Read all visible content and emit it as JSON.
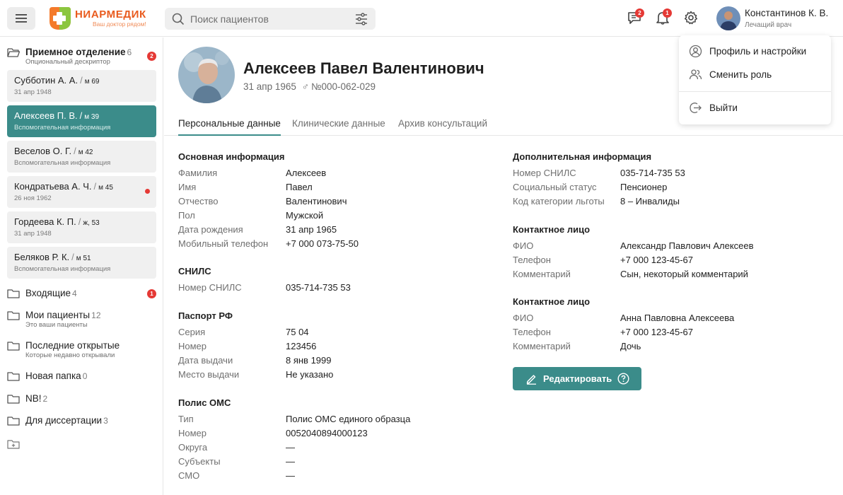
{
  "header": {
    "logo_name": "НИАРМЕДИК",
    "logo_tagline": "Ваш доктор рядом!",
    "search_placeholder": "Поиск пациентов",
    "messages_badge": "2",
    "notifications_badge": "1",
    "user_name": "Константинов К. В.",
    "user_role": "Лечащий врач"
  },
  "dropdown": {
    "profile": "Профиль и настройки",
    "switch_role": "Сменить роль",
    "logout": "Выйти"
  },
  "sidebar": {
    "reception": {
      "name": "Приемное отделение",
      "count": "6",
      "desc": "Опциональный дескриптор",
      "badge": "2"
    },
    "patients": [
      {
        "name": "Субботин А. А.",
        "meta": "м 69",
        "sub": "31 апр 1948"
      },
      {
        "name": "Алексеев П. В.",
        "meta": "м 39",
        "sub": "Вспомогательная информация"
      },
      {
        "name": "Веселов О. Г.",
        "meta": "м 42",
        "sub": "Вспомогательная информация"
      },
      {
        "name": "Кондратьева А. Ч.",
        "meta": "м 45",
        "sub": "26 ноя 1962"
      },
      {
        "name": "Гордеева К. П.",
        "meta": "ж, 53",
        "sub": "31 апр 1948"
      },
      {
        "name": "Беляков Р. К.",
        "meta": "м 51",
        "sub": "Вспомогательная информация"
      }
    ],
    "folders": [
      {
        "name": "Входящие",
        "count": "4",
        "desc": "",
        "badge": "1"
      },
      {
        "name": "Мои пациенты",
        "count": "12",
        "desc": "Это ваши пациенты"
      },
      {
        "name": "Последние открытые",
        "count": "",
        "desc": "Которые недавно открывали"
      },
      {
        "name": "Новая папка",
        "count": "0",
        "desc": ""
      },
      {
        "name": "NB!",
        "count": "2",
        "desc": ""
      },
      {
        "name": "Для диссертации",
        "count": "3",
        "desc": ""
      }
    ]
  },
  "patient": {
    "name": "Алексеев Павел Валентинович",
    "birth": "31 апр 1965",
    "gender_symbol": "♂",
    "card_number": "№000-062-029"
  },
  "tabs": [
    "Персональные данные",
    "Клинические данные",
    "Архив консультаций"
  ],
  "basic": {
    "title": "Основная информация",
    "rows": [
      {
        "label": "Фамилия",
        "value": "Алексеев"
      },
      {
        "label": "Имя",
        "value": "Павел"
      },
      {
        "label": "Отчество",
        "value": "Валентинович"
      },
      {
        "label": "Пол",
        "value": "Мужской"
      },
      {
        "label": "Дата рождения",
        "value": "31 апр 1965"
      },
      {
        "label": "Мобильный телефон",
        "value": "+7 000 073-75-50"
      }
    ]
  },
  "snils": {
    "title": "СНИЛС",
    "rows": [
      {
        "label": "Номер СНИЛС",
        "value": "035-714-735 53"
      }
    ]
  },
  "passport": {
    "title": "Паспорт РФ",
    "rows": [
      {
        "label": "Серия",
        "value": "75 04"
      },
      {
        "label": "Номер",
        "value": "123456"
      },
      {
        "label": "Дата выдачи",
        "value": "8 янв 1999"
      },
      {
        "label": "Место выдачи",
        "value": "Не указано"
      }
    ]
  },
  "oms": {
    "title": "Полис ОМС",
    "rows": [
      {
        "label": "Тип",
        "value": "Полис ОМС единого образца"
      },
      {
        "label": "Номер",
        "value": "0052040894000123"
      },
      {
        "label": "Округа",
        "value": "—"
      },
      {
        "label": "Субъекты",
        "value": "—"
      },
      {
        "label": "СМО",
        "value": "—"
      }
    ]
  },
  "additional": {
    "title": "Дополнительная информация",
    "rows": [
      {
        "label": "Номер СНИЛС",
        "value": "035-714-735 53"
      },
      {
        "label": "Социальный статус",
        "value": "Пенсионер"
      },
      {
        "label": "Код категории льготы",
        "value": "8 – Инвалиды"
      }
    ]
  },
  "contact1": {
    "title": "Контактное лицо",
    "rows": [
      {
        "label": "ФИО",
        "value": "Александр Павлович Алексеев"
      },
      {
        "label": "Телефон",
        "value": "+7 000 123-45-67"
      },
      {
        "label": "Комментарий",
        "value": "Сын, некоторый комментарий"
      }
    ]
  },
  "contact2": {
    "title": "Контактное лицо",
    "rows": [
      {
        "label": "ФИО",
        "value": "Анна Павловна Алексеева"
      },
      {
        "label": "Телефон",
        "value": "+7 000 123-45-67"
      },
      {
        "label": "Комментарий",
        "value": "Дочь"
      }
    ]
  },
  "edit_button": "Редактировать",
  "colors": {
    "accent": "#3b8c8a",
    "brand": "#e95b1e",
    "badge": "#e53935"
  }
}
